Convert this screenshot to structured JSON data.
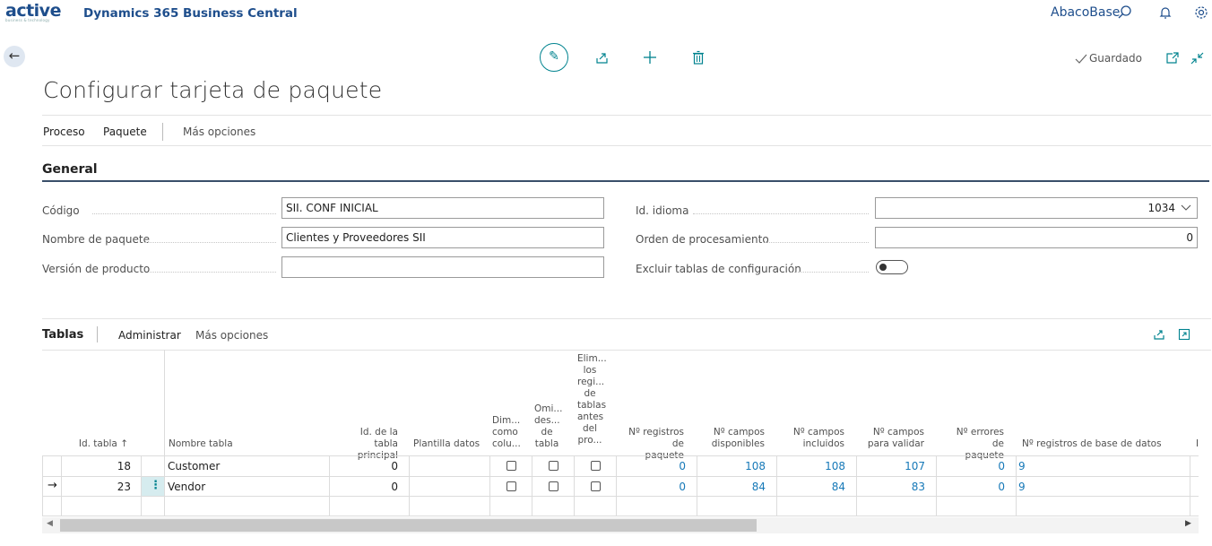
{
  "brand": {
    "logo_text": "active",
    "logo_sub": "business & technology",
    "app_title": "Dynamics 365 Business Central"
  },
  "header": {
    "company": "AbacoBase",
    "search_icon": "search-icon",
    "bell_icon": "bell-icon",
    "settings_icon": "gear-icon"
  },
  "toolbar": {
    "back_icon": "back-arrow-icon",
    "edit_icon": "pencil-icon",
    "share_icon": "share-icon",
    "new_icon": "plus-icon",
    "delete_icon": "trash-icon",
    "saved_label": "Guardado",
    "open_new_icon": "open-new-window-icon",
    "collapse_icon": "collapse-icon"
  },
  "page": {
    "title": "Configurar tarjeta de paquete"
  },
  "actions": [
    "Proceso",
    "Paquete",
    "Más opciones"
  ],
  "general": {
    "title": "General",
    "fields_left": [
      {
        "label": "Código",
        "value": "SII. CONF INICIAL"
      },
      {
        "label": "Nombre de paquete",
        "value": "Clientes y Proveedores SII"
      },
      {
        "label": "Versión de producto",
        "value": ""
      }
    ],
    "fields_right": [
      {
        "label": "Id. idioma",
        "value": "1034"
      },
      {
        "label": "Orden de procesamiento",
        "value": "0"
      },
      {
        "label": "Excluir tablas de configuración",
        "value": "off"
      }
    ]
  },
  "tablas": {
    "title": "Tablas",
    "actions": [
      "Administrar",
      "Más opciones"
    ],
    "columns": [
      "Id. tabla ↑",
      "Nombre tabla",
      "Id. de la tabla principal",
      "Plantilla datos",
      "Dim... como colu...",
      "Omi... des... de tabla",
      "Elim... los regi... de tablas antes del pro...",
      "Nº registros de paquete",
      "Nº campos disponibles",
      "Nº campos incluidos",
      "Nº campos para validar",
      "Nº errores de paquete",
      "Nº registros de base de datos"
    ],
    "rows": [
      {
        "id": "18",
        "name": "Customer",
        "parent": "0",
        "template": "",
        "c1": false,
        "c2": false,
        "c3": false,
        "pkg_records": "0",
        "avail": "108",
        "incl": "108",
        "valid": "107",
        "errors": "0",
        "db_records": "9"
      },
      {
        "id": "23",
        "name": "Vendor",
        "parent": "0",
        "template": "",
        "c1": false,
        "c2": false,
        "c3": false,
        "pkg_records": "0",
        "avail": "84",
        "incl": "84",
        "valid": "83",
        "errors": "0",
        "db_records": "9"
      }
    ]
  }
}
